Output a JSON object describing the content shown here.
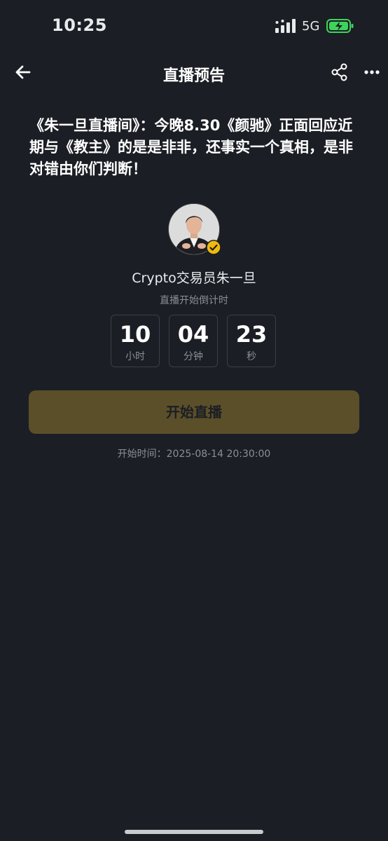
{
  "status_bar": {
    "time": "10:25",
    "network": "5G",
    "battery_color": "#3ed35c"
  },
  "header": {
    "title": "直播预告",
    "back_icon": "arrow-left-icon",
    "share_icon": "share-icon",
    "more_icon": "more-dots-icon"
  },
  "announcement": {
    "title": "《朱一旦直播间》：今晚8.30《颜驰》正面回应近期与《教主》的是是非非，还事实一个真相，是非对错由你们判断！"
  },
  "host": {
    "name": "Crypto交易员朱一旦",
    "verified_badge_color": "#f0b90b"
  },
  "countdown": {
    "label": "直播开始倒计时",
    "hours": "10",
    "hours_unit": "小时",
    "minutes": "04",
    "minutes_unit": "分钟",
    "seconds": "23",
    "seconds_unit": "秒"
  },
  "start_button": {
    "label": "开始直播",
    "color": "#5b4f2a"
  },
  "start_time": {
    "text": "开始时间：2025-08-14 20:30:00"
  }
}
